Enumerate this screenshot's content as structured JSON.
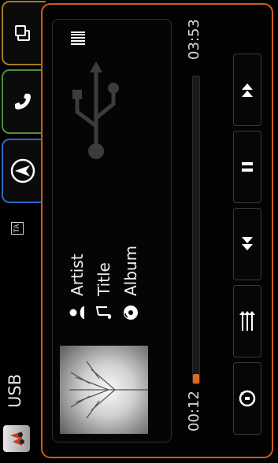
{
  "status_bar": {
    "source_label": "USB",
    "ta_label": "TA"
  },
  "track": {
    "artist": "Artist",
    "title": "Title",
    "album": "Album",
    "elapsed": "00:12",
    "total": "03:53",
    "progress_fraction": 0.03
  },
  "colors": {
    "accent_orange": "#e2681f",
    "panel_border": "#d25a1a",
    "nav_tab": "#2f67c4",
    "phone_tab": "#4f8e3a",
    "media_tab": "#a67a22"
  },
  "icons": {
    "source": "music-source-icon",
    "nav": "navigation-icon",
    "phone": "phone-icon",
    "media": "media-device-icon",
    "usb": "usb-icon",
    "list": "list-icon",
    "artist": "person-icon",
    "title": "music-note-icon",
    "album": "disc-icon",
    "repeat": "repeat-icon",
    "shuffle": "shuffle-icon",
    "previous": "previous-icon",
    "pause": "pause-icon",
    "next": "next-icon"
  }
}
